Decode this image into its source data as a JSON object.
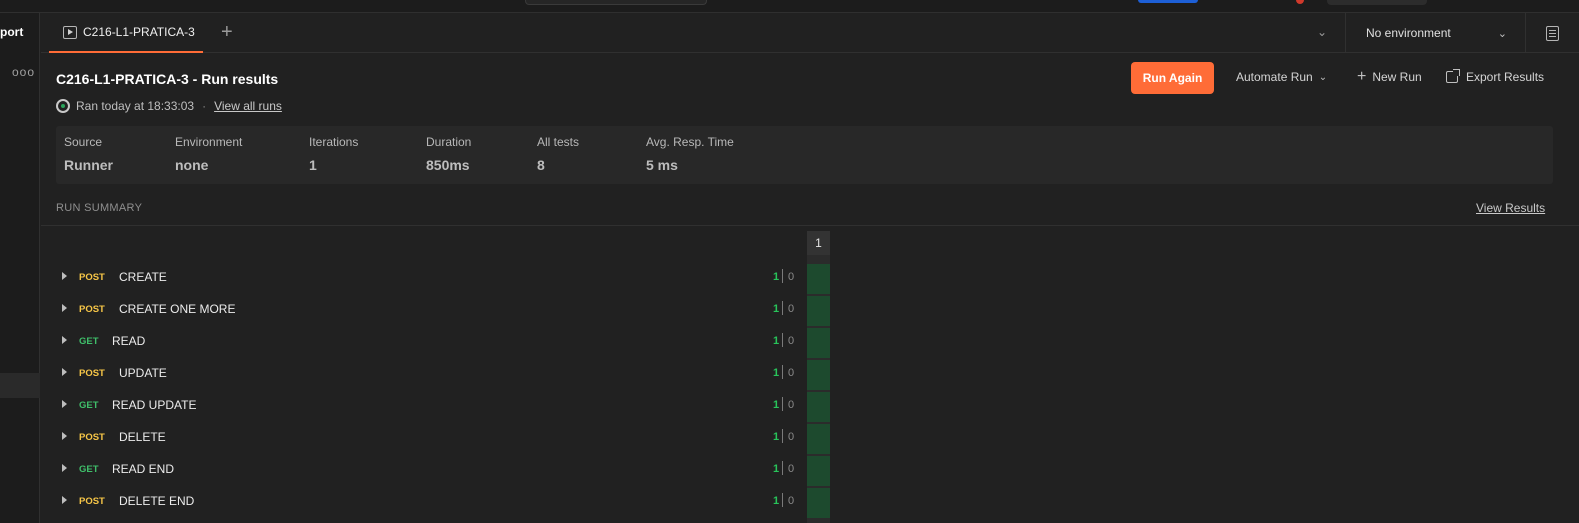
{
  "sidebar": {
    "import_label": "port",
    "more_label": "ooo"
  },
  "tabbar": {
    "active_tab_label": "C216-L1-PRATICA-3",
    "add_tab": "+",
    "environment": "No environment"
  },
  "header": {
    "title": "C216-L1-PRATICA-3 - Run results",
    "ran_text": "Ran today at 18:33:03",
    "separator": "·",
    "view_all_runs": "View all runs",
    "run_again": "Run Again",
    "automate_run": "Automate Run",
    "new_run": "New Run",
    "export_results": "Export Results"
  },
  "stats": [
    {
      "label": "Source",
      "value": "Runner"
    },
    {
      "label": "Environment",
      "value": "none"
    },
    {
      "label": "Iterations",
      "value": "1"
    },
    {
      "label": "Duration",
      "value": "850ms"
    },
    {
      "label": "All tests",
      "value": "8"
    },
    {
      "label": "Avg. Resp. Time",
      "value": "5 ms"
    }
  ],
  "summary": {
    "heading": "RUN SUMMARY",
    "view_results": "View Results",
    "iteration_header": "1"
  },
  "requests": [
    {
      "method": "POST",
      "name": "CREATE",
      "passed": "1",
      "failed": "0"
    },
    {
      "method": "POST",
      "name": "CREATE ONE MORE",
      "passed": "1",
      "failed": "0"
    },
    {
      "method": "GET",
      "name": "READ",
      "passed": "1",
      "failed": "0"
    },
    {
      "method": "POST",
      "name": "UPDATE",
      "passed": "1",
      "failed": "0"
    },
    {
      "method": "GET",
      "name": "READ UPDATE",
      "passed": "1",
      "failed": "0"
    },
    {
      "method": "POST",
      "name": "DELETE",
      "passed": "1",
      "failed": "0"
    },
    {
      "method": "GET",
      "name": "READ END",
      "passed": "1",
      "failed": "0"
    },
    {
      "method": "POST",
      "name": "DELETE END",
      "passed": "1",
      "failed": "0"
    }
  ],
  "colors": {
    "accent": "#ff6c37",
    "post": "#f7c647",
    "get": "#3fbf6a",
    "pass": "#28c45a",
    "cell_pass": "#1d4a2e"
  }
}
